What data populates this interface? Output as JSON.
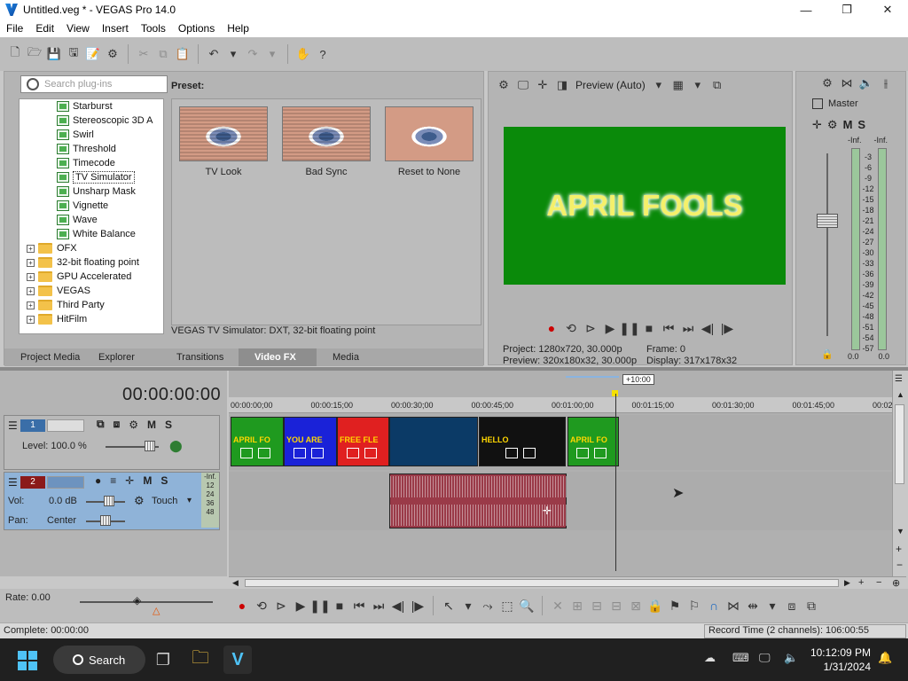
{
  "window": {
    "title": "Untitled.veg * - VEGAS Pro 14.0",
    "minimize": "—",
    "maximize": "❐",
    "close": "✕"
  },
  "menu": [
    "File",
    "Edit",
    "View",
    "Insert",
    "Tools",
    "Options",
    "Help"
  ],
  "plugins": {
    "search_placeholder": "Search plug-ins",
    "tree": [
      {
        "label": "Starburst",
        "type": "fx"
      },
      {
        "label": "Stereoscopic 3D A",
        "type": "fx"
      },
      {
        "label": "Swirl",
        "type": "fx"
      },
      {
        "label": "Threshold",
        "type": "fx"
      },
      {
        "label": "Timecode",
        "type": "fx"
      },
      {
        "label": "TV Simulator",
        "type": "fx",
        "selected": true
      },
      {
        "label": "Unsharp Mask",
        "type": "fx"
      },
      {
        "label": "Vignette",
        "type": "fx"
      },
      {
        "label": "Wave",
        "type": "fx"
      },
      {
        "label": "White Balance",
        "type": "fx"
      },
      {
        "label": "OFX",
        "type": "folder"
      },
      {
        "label": "32-bit floating point",
        "type": "folder"
      },
      {
        "label": "GPU Accelerated",
        "type": "folder"
      },
      {
        "label": "VEGAS",
        "type": "folder"
      },
      {
        "label": "Third Party",
        "type": "folder"
      },
      {
        "label": "HitFilm",
        "type": "folder"
      }
    ],
    "preset_label": "Preset:",
    "presets": [
      "TV Look",
      "Bad Sync",
      "Reset to None"
    ],
    "status": "VEGAS TV Simulator: DXT, 32-bit floating point",
    "tabs": [
      "Project Media",
      "Explorer",
      "Transitions",
      "Video FX",
      "Media Generators"
    ],
    "active_tab": "Video FX"
  },
  "preview": {
    "quality": "Preview (Auto)",
    "overlay_text": "APRIL FOOLS",
    "project_label": "Project:",
    "project_value": "1280x720, 30.000p",
    "frame_label": "Frame:",
    "frame_value": "0",
    "preview_label": "Preview:",
    "preview_value": "320x180x32, 30.000p",
    "display_label": "Display:",
    "display_value": "317x178x32"
  },
  "master": {
    "label": "Master",
    "mute": "M",
    "solo": "S",
    "peak_left": "-Inf.",
    "peak_right": "-Inf.",
    "scale": [
      "3",
      "6",
      "9",
      "12",
      "15",
      "18",
      "21",
      "24",
      "27",
      "30",
      "33",
      "36",
      "39",
      "42",
      "45",
      "48",
      "51",
      "54",
      "57"
    ],
    "scale_prefix": "-",
    "value_left": "0.0",
    "value_right": "0.0"
  },
  "timeline": {
    "timecode": "00:00:00:00",
    "ruler": [
      "00:00:00;00",
      "00:00:15;00",
      "00:00:30;00",
      "00:00:45;00",
      "00:01:00;00",
      "00:01:15;00",
      "00:01:30;00",
      "00:01:45;00",
      "00:02"
    ],
    "loop_badge": "+10:00",
    "video_track": {
      "number": "1",
      "level": "Level: 100.0 %",
      "mute": "M",
      "solo": "S"
    },
    "audio_track": {
      "number": "2",
      "vol_label": "Vol:",
      "vol_value": "0.0 dB",
      "pan_label": "Pan:",
      "pan_value": "Center",
      "mode": "Touch",
      "mute": "M",
      "solo": "S",
      "meter_inf": "-Inf.",
      "meter_scale": [
        "12",
        "24",
        "36",
        "48"
      ]
    },
    "clips": [
      {
        "caption": "APRIL FO",
        "color": "#1f9a1f"
      },
      {
        "caption": "YOU ARE",
        "color": "#1a22d8"
      },
      {
        "caption": "FREE FLE",
        "color": "#e02020"
      },
      {
        "caption": "",
        "color": "#0b3a66"
      },
      {
        "caption": "HELLO",
        "color": "#111111"
      },
      {
        "caption": "APRIL FO",
        "color": "#1f9a1f"
      }
    ],
    "rate": "Rate: 0.00"
  },
  "status": {
    "left": "Complete: 00:00:00",
    "right": "Record Time (2 channels): 106:00:55"
  },
  "taskbar": {
    "search": "Search",
    "time": "10:12:09 PM",
    "date": "1/31/2024"
  }
}
